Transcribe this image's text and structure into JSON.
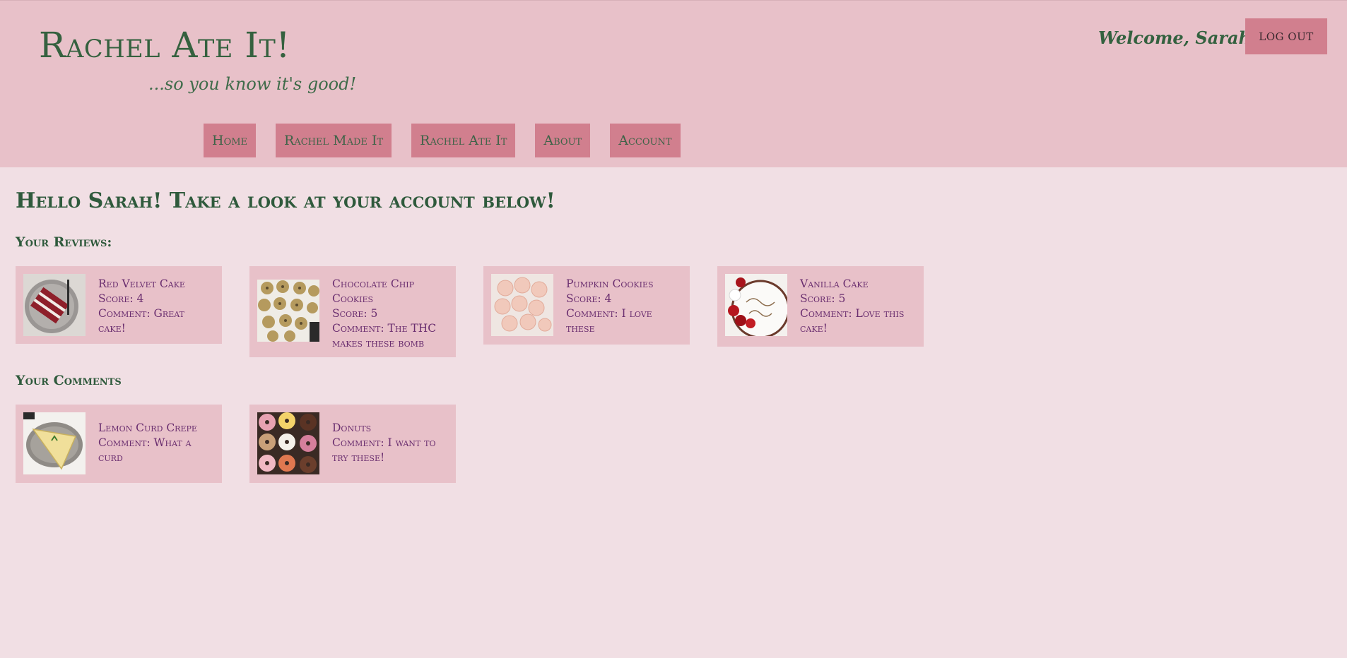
{
  "header": {
    "site_title": "Rachel Ate It!",
    "tagline": "...so you know it's good!",
    "welcome": "Welcome, Sarah!",
    "logout_label": "LOG OUT"
  },
  "nav": {
    "items": [
      {
        "label": "Home"
      },
      {
        "label": "Rachel Made It"
      },
      {
        "label": "Rachel Ate It"
      },
      {
        "label": "About"
      },
      {
        "label": "Account"
      }
    ]
  },
  "main": {
    "greeting": "Hello Sarah! Take a look at your account below!",
    "reviews_title": "Your Reviews:",
    "comments_title": "Your Comments"
  },
  "reviews": [
    {
      "name": "Red Velvet Cake",
      "score": "Score: 4",
      "comment": "Comment: Great cake!",
      "image_icon": "red-velvet-cake-image"
    },
    {
      "name": "Chocolate Chip Cookies",
      "score": "Score: 5",
      "comment": "Comment: The THC makes these bomb",
      "image_icon": "chocolate-chip-cookies-image"
    },
    {
      "name": "Pumpkin Cookies",
      "score": "Score: 4",
      "comment": "Comment: I love these",
      "image_icon": "pumpkin-cookies-image"
    },
    {
      "name": "Vanilla Cake",
      "score": "Score: 5",
      "comment": "Comment: Love this cake!",
      "image_icon": "vanilla-cake-image"
    }
  ],
  "comments": [
    {
      "name": "Lemon Curd Crepe",
      "comment": "Comment: What a curd",
      "image_icon": "lemon-curd-crepe-image"
    },
    {
      "name": "Donuts",
      "comment": "Comment: I want to try these!",
      "image_icon": "donuts-image"
    }
  ],
  "colors": {
    "page_bg": "#f1dfe4",
    "header_bg": "#e8c1c9",
    "button_bg": "#d17f8e",
    "title_green": "#2f5a3c",
    "card_text": "#6a2e6f"
  }
}
